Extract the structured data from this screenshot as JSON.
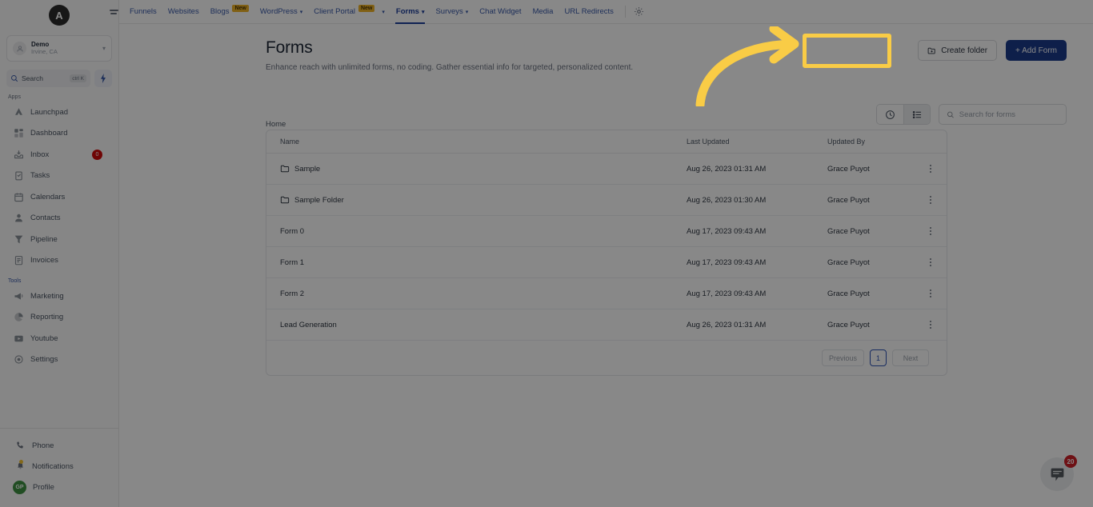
{
  "sidebar": {
    "logo_letter": "A",
    "account": {
      "name": "Demo",
      "location": "Irvine, CA"
    },
    "search": {
      "label": "Search",
      "shortcut": "ctrl K"
    },
    "sections": [
      {
        "title": "Apps",
        "items": [
          {
            "label": "Launchpad",
            "icon": "rocket-icon"
          },
          {
            "label": "Dashboard",
            "icon": "dashboard-icon"
          },
          {
            "label": "Inbox",
            "icon": "inbox-icon",
            "badge": "0"
          },
          {
            "label": "Tasks",
            "icon": "tasks-icon"
          },
          {
            "label": "Calendars",
            "icon": "calendar-icon"
          },
          {
            "label": "Contacts",
            "icon": "contacts-icon"
          },
          {
            "label": "Pipeline",
            "icon": "pipeline-icon"
          },
          {
            "label": "Invoices",
            "icon": "invoices-icon"
          }
        ]
      },
      {
        "title": "Tools",
        "items": [
          {
            "label": "Marketing",
            "icon": "megaphone-icon"
          },
          {
            "label": "Reporting",
            "icon": "pie-chart-icon"
          },
          {
            "label": "Youtube",
            "icon": "youtube-icon"
          },
          {
            "label": "Settings",
            "icon": "gear-icon"
          }
        ]
      }
    ],
    "bottom": [
      {
        "label": "Phone",
        "icon": "phone-icon"
      },
      {
        "label": "Notifications",
        "icon": "bell-icon"
      },
      {
        "label": "Profile",
        "icon": "avatar-icon",
        "initials": "GP"
      }
    ]
  },
  "topnav": {
    "items": [
      {
        "label": "Funnels",
        "caret": false,
        "badge": null,
        "active": false
      },
      {
        "label": "Websites",
        "caret": false,
        "badge": null,
        "active": false
      },
      {
        "label": "Blogs",
        "caret": false,
        "badge": "New",
        "active": false
      },
      {
        "label": "WordPress",
        "caret": true,
        "badge": null,
        "active": false
      },
      {
        "label": "Client Portal",
        "caret": true,
        "badge": "New",
        "active": false
      },
      {
        "label": "Forms",
        "caret": true,
        "badge": null,
        "active": true
      },
      {
        "label": "Surveys",
        "caret": true,
        "badge": null,
        "active": false
      },
      {
        "label": "Chat Widget",
        "caret": false,
        "badge": null,
        "active": false
      },
      {
        "label": "Media",
        "caret": false,
        "badge": null,
        "active": false
      },
      {
        "label": "URL Redirects",
        "caret": false,
        "badge": null,
        "active": false
      }
    ],
    "settings_icon": "gear-icon"
  },
  "page": {
    "title": "Forms",
    "subtitle": "Enhance reach with unlimited forms, no coding. Gather essential info for targeted, personalized content.",
    "create_folder_label": "Create folder",
    "add_form_label": "+ Add Form",
    "breadcrumb": "Home"
  },
  "toolbar": {
    "recent_icon": "clock-icon",
    "list_icon": "list-view-icon",
    "search_placeholder": "Search for forms",
    "search_value": ""
  },
  "table": {
    "columns": [
      "Name",
      "Last Updated",
      "Updated By"
    ],
    "rows": [
      {
        "name": "Sample",
        "is_folder": true,
        "last_updated": "Aug 26, 2023 01:31 AM",
        "updated_by": "Grace Puyot"
      },
      {
        "name": "Sample Folder",
        "is_folder": true,
        "last_updated": "Aug 26, 2023 01:30 AM",
        "updated_by": "Grace Puyot"
      },
      {
        "name": "Form 0",
        "is_folder": false,
        "last_updated": "Aug 17, 2023 09:43 AM",
        "updated_by": "Grace Puyot"
      },
      {
        "name": "Form 1",
        "is_folder": false,
        "last_updated": "Aug 17, 2023 09:43 AM",
        "updated_by": "Grace Puyot"
      },
      {
        "name": "Form 2",
        "is_folder": false,
        "last_updated": "Aug 17, 2023 09:43 AM",
        "updated_by": "Grace Puyot"
      },
      {
        "name": "Lead Generation",
        "is_folder": false,
        "last_updated": "Aug 26, 2023 01:31 AM",
        "updated_by": "Grace Puyot"
      }
    ],
    "pagination": {
      "previous": "Previous",
      "current_page": "1",
      "next": "Next"
    }
  },
  "chat_widget": {
    "badge_count": "20",
    "icon": "chat-bubble-icon"
  },
  "annotation": {
    "highlight_color": "#f9cc46",
    "arrow_color": "#f9cc46",
    "target": "create-folder-button"
  },
  "colors": {
    "accent_blue": "#1b3a8c",
    "link_blue": "#3858a8",
    "badge_red": "#cf2029",
    "new_badge": "#f0b429",
    "highlight_yellow": "#f9cc46",
    "avatar_green": "#3f9142"
  }
}
